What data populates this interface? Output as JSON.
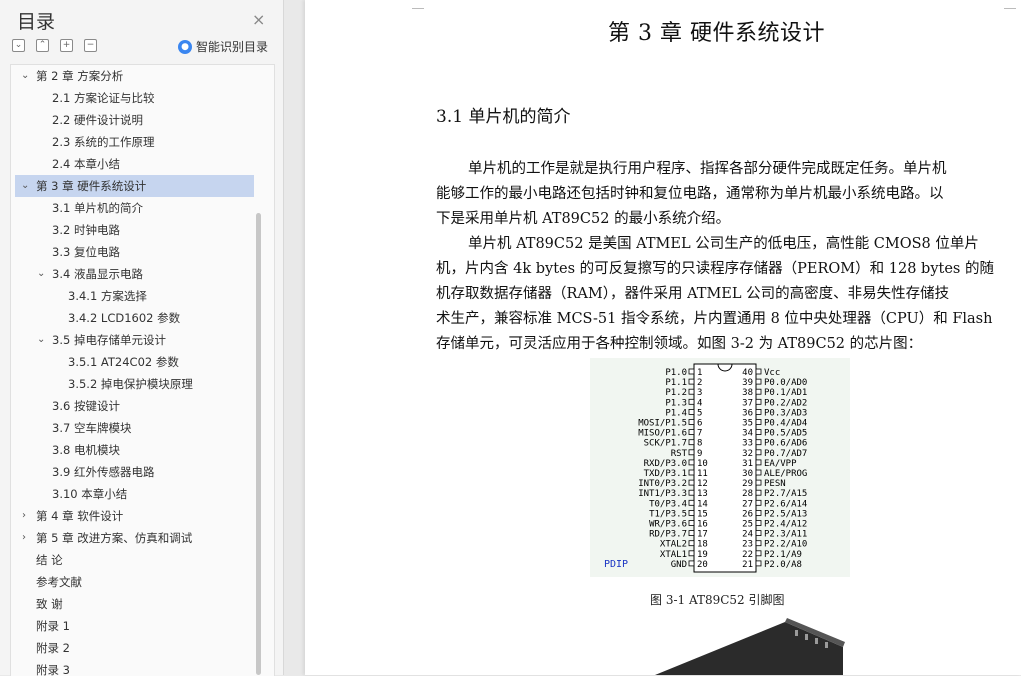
{
  "sidebar": {
    "title": "目录",
    "close": "×",
    "tools": [
      "⌄",
      "⌃",
      "+",
      "−"
    ],
    "smart_label": "智能识别目录",
    "items": [
      {
        "label": "第 2 章  方案分析",
        "arrow": "⌄"
      },
      {
        "label": "2.1  方案论证与比较"
      },
      {
        "label": "2.2  硬件设计说明"
      },
      {
        "label": "2.3  系统的工作原理"
      },
      {
        "label": "2.4  本章小结"
      },
      {
        "label": "第 3 章  硬件系统设计",
        "arrow": "⌄"
      },
      {
        "label": "3.1  单片机的简介"
      },
      {
        "label": "3.2  时钟电路"
      },
      {
        "label": "3.3  复位电路"
      },
      {
        "label": "3.4  液晶显示电路",
        "arrow": "⌄"
      },
      {
        "label": "3.4.1  方案选择"
      },
      {
        "label": "3.4.2 LCD1602 参数"
      },
      {
        "label": "3.5  掉电存储单元设计",
        "arrow": "⌄"
      },
      {
        "label": "3.5.1 AT24C02 参数"
      },
      {
        "label": "3.5.2  掉电保护模块原理"
      },
      {
        "label": "3.6  按键设计"
      },
      {
        "label": "3.7  空车牌模块"
      },
      {
        "label": "3.8  电机模块"
      },
      {
        "label": "3.9  红外传感器电路"
      },
      {
        "label": "3.10  本章小结"
      },
      {
        "label": "第 4 章  软件设计",
        "arrow": "›"
      },
      {
        "label": "第 5 章  改进方案、仿真和调试",
        "arrow": "›"
      },
      {
        "label": "结  论"
      },
      {
        "label": "参考文献"
      },
      {
        "label": "致  谢"
      },
      {
        "label": "附录 1"
      },
      {
        "label": "附录 2"
      },
      {
        "label": "附录 3"
      }
    ]
  },
  "document": {
    "chapter_title": "第 3 章  硬件系统设计",
    "section_title": "3.1  单片机的简介",
    "lines": [
      "单片机的工作是就是执行用户程序、指挥各部分硬件完成既定任务。单片机",
      "能够工作的最小电路还包括时钟和复位电路，通常称为单片机最小系统电路。以",
      "下是采用单片机 AT89C52 的最小系统介绍。",
      "单片机 AT89C52 是美国 ATMEL 公司生产的低电压，高性能 CMOS8 位单片",
      "机，片内含 4k bytes 的可反复擦写的只读程序存储器（PEROM）和 128 bytes 的随",
      "机存取数据存储器（RAM），器件采用 ATMEL 公司的高密度、非易失性存储技",
      "术生产，兼容标准 MCS-51 指令系统，片内置通用 8 位中央处理器（CPU）和 Flash",
      "存储单元，可灵活应用于各种控制领域。如图 3-2 为 AT89C52 的芯片图："
    ],
    "figure": {
      "package_label": "PDIP",
      "left_pins": [
        "P1.0",
        "P1.1",
        "P1.2",
        "P1.3",
        "P1.4",
        "MOSI/P1.5",
        "MISO/P1.6",
        "SCK/P1.7",
        "RST",
        "RXD/P3.0",
        "TXD/P3.1",
        "INT0/P3.2",
        "INT1/P3.3",
        "T0/P3.4",
        "T1/P3.5",
        "WR/P3.6",
        "RD/P3.7",
        "XTAL2",
        "XTAL1",
        "GND"
      ],
      "right_pins": [
        "Vcc",
        "P0.0/AD0",
        "P0.1/AD1",
        "P0.2/AD2",
        "P0.3/AD3",
        "P0.4/AD4",
        "P0.5/AD5",
        "P0.6/AD6",
        "P0.7/AD7",
        "EA/VPP",
        "ALE/PROG",
        "PESN",
        "P2.7/A15",
        "P2.6/A14",
        "P2.5/A13",
        "P2.4/A12",
        "P2.3/A11",
        "P2.2/A10",
        "P2.1/A9",
        "P2.0/A8"
      ],
      "left_nums": [
        "1",
        "2",
        "3",
        "4",
        "5",
        "6",
        "7",
        "8",
        "9",
        "10",
        "11",
        "12",
        "13",
        "14",
        "15",
        "16",
        "17",
        "18",
        "19",
        "20"
      ],
      "right_nums": [
        "40",
        "39",
        "38",
        "37",
        "36",
        "35",
        "34",
        "33",
        "32",
        "31",
        "30",
        "29",
        "28",
        "27",
        "26",
        "25",
        "24",
        "23",
        "22",
        "21"
      ],
      "caption": "图 3-1 AT89C52 引脚图"
    }
  }
}
